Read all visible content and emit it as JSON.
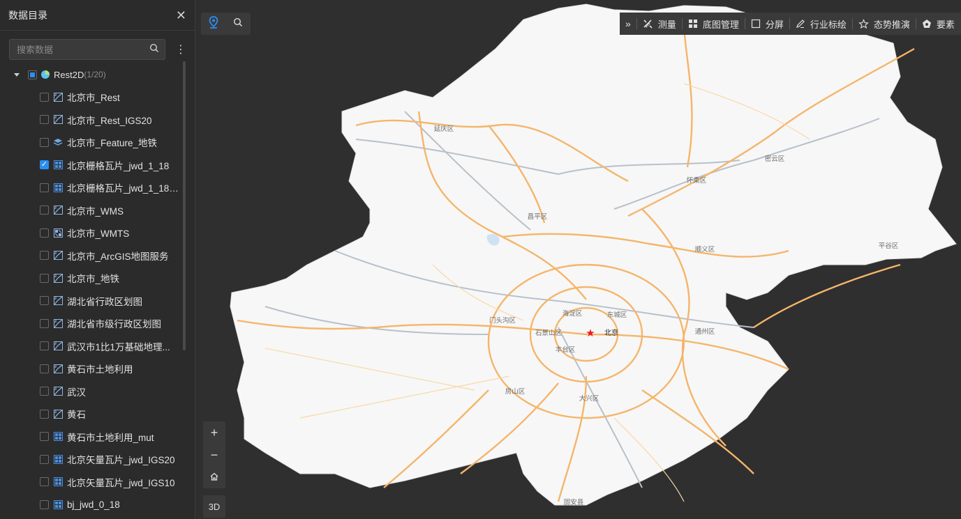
{
  "sidebar": {
    "title": "数据目录",
    "search_placeholder": "搜索数据",
    "root": {
      "label": "Rest2D",
      "count": "(1/20)"
    },
    "items": [
      {
        "label": "北京市_Rest",
        "icon": "raster-layer-icon",
        "checked": false
      },
      {
        "label": "北京市_Rest_IGS20",
        "icon": "raster-layer-icon",
        "checked": false
      },
      {
        "label": "北京市_Feature_地铁",
        "icon": "stack-layer-icon",
        "checked": false
      },
      {
        "label": "北京栅格瓦片_jwd_1_18",
        "icon": "tile-layer-icon",
        "checked": true
      },
      {
        "label": "北京栅格瓦片_jwd_1_18_...",
        "icon": "tile-layer-icon",
        "checked": false
      },
      {
        "label": "北京市_WMS",
        "icon": "raster-layer-icon",
        "checked": false
      },
      {
        "label": "北京市_WMTS",
        "icon": "wmts-layer-icon",
        "checked": false
      },
      {
        "label": "北京市_ArcGIS地图服务",
        "icon": "raster-layer-icon",
        "checked": false
      },
      {
        "label": "北京市_地铁",
        "icon": "raster-layer-icon",
        "checked": false
      },
      {
        "label": "湖北省行政区划图",
        "icon": "raster-layer-icon",
        "checked": false
      },
      {
        "label": "湖北省市级行政区划图",
        "icon": "raster-layer-icon",
        "checked": false
      },
      {
        "label": "武汉市1比1万基础地理...",
        "icon": "raster-layer-icon",
        "checked": false
      },
      {
        "label": "黄石市土地利用",
        "icon": "raster-layer-icon",
        "checked": false
      },
      {
        "label": "武汉",
        "icon": "raster-layer-icon",
        "checked": false
      },
      {
        "label": "黄石",
        "icon": "raster-layer-icon",
        "checked": false
      },
      {
        "label": "黄石市土地利用_mut",
        "icon": "tile-layer-icon",
        "checked": false
      },
      {
        "label": "北京矢量瓦片_jwd_IGS20",
        "icon": "tile-layer-icon",
        "checked": false
      },
      {
        "label": "北京矢量瓦片_jwd_IGS10",
        "icon": "tile-layer-icon",
        "checked": false
      },
      {
        "label": "bj_jwd_0_18",
        "icon": "tile-layer-icon",
        "checked": false
      }
    ]
  },
  "toolbar": {
    "items": [
      {
        "label": "测量",
        "icon": "ruler-icon"
      },
      {
        "label": "底图管理",
        "icon": "basemap-grid-icon"
      },
      {
        "label": "分屏",
        "icon": "split-screen-icon"
      },
      {
        "label": "行业标绘",
        "icon": "pen-icon"
      },
      {
        "label": "态势推演",
        "icon": "star-icon"
      },
      {
        "label": "要素",
        "icon": "pentagon-icon"
      }
    ]
  },
  "map": {
    "center_label": "北京",
    "districts": [
      "延庆区",
      "密云区",
      "怀柔区",
      "昌平区",
      "顺义区",
      "平谷区",
      "门头沟区",
      "海淀区",
      "东城区",
      "石景山区",
      "通州区",
      "丰台区",
      "房山区",
      "大兴区",
      "固安县"
    ]
  },
  "controls": {
    "btn_3d": "3D"
  },
  "colors": {
    "accent": "#2b8ef0",
    "road": "#f5b56a",
    "rail": "#aeb8c4",
    "land": "#f7f7f7"
  }
}
